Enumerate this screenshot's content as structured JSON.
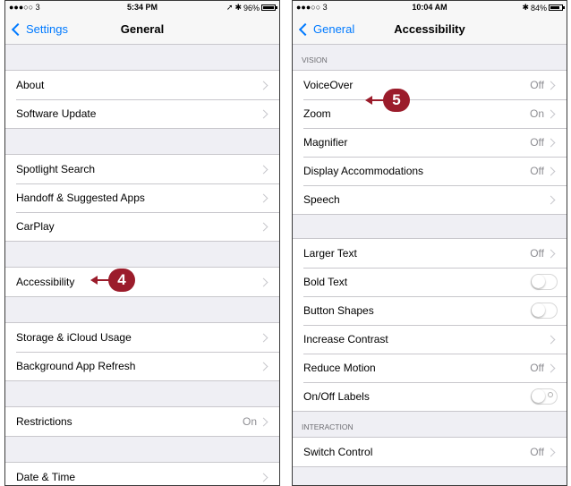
{
  "left": {
    "status": {
      "carrier": "●●●○○ 3 ",
      "time": "5:34 PM",
      "battery": "96%",
      "battery_fill": 0.96
    },
    "nav": {
      "back": "Settings",
      "title": "General"
    },
    "groups": [
      [
        {
          "label": "About"
        },
        {
          "label": "Software Update"
        }
      ],
      [
        {
          "label": "Spotlight Search"
        },
        {
          "label": "Handoff & Suggested Apps"
        },
        {
          "label": "CarPlay"
        }
      ],
      [
        {
          "label": "Accessibility"
        }
      ],
      [
        {
          "label": "Storage & iCloud Usage"
        },
        {
          "label": "Background App Refresh"
        }
      ],
      [
        {
          "label": "Restrictions",
          "value": "On"
        }
      ],
      [
        {
          "label": "Date & Time"
        }
      ]
    ],
    "callout": "4"
  },
  "right": {
    "status": {
      "carrier": "●●●○○ 3 ",
      "time": "10:04 AM",
      "battery": "84%",
      "battery_fill": 0.84
    },
    "nav": {
      "back": "General",
      "title": "Accessibility"
    },
    "sections": {
      "vision": "VISION",
      "interaction": "INTERACTION"
    },
    "vision_rows": [
      {
        "label": "VoiceOver",
        "value": "Off"
      },
      {
        "label": "Zoom",
        "value": "On"
      },
      {
        "label": "Magnifier",
        "value": "Off"
      },
      {
        "label": "Display Accommodations",
        "value": "Off"
      },
      {
        "label": "Speech",
        "value": ""
      }
    ],
    "text_rows": [
      {
        "label": "Larger Text",
        "value": "Off",
        "type": "chevron"
      },
      {
        "label": "Bold Text",
        "type": "toggle",
        "on": false
      },
      {
        "label": "Button Shapes",
        "type": "toggle",
        "on": false
      },
      {
        "label": "Increase Contrast",
        "value": "",
        "type": "chevron"
      },
      {
        "label": "Reduce Motion",
        "value": "Off",
        "type": "chevron"
      },
      {
        "label": "On/Off Labels",
        "type": "toggle",
        "on": false,
        "labels": true
      }
    ],
    "interaction_rows": [
      {
        "label": "Switch Control",
        "value": "Off"
      }
    ],
    "callout": "5"
  },
  "icons": {
    "bluetooth": "✱",
    "location": "➚"
  },
  "colors": {
    "accent": "#007aff",
    "callout": "#9b1c2b"
  }
}
